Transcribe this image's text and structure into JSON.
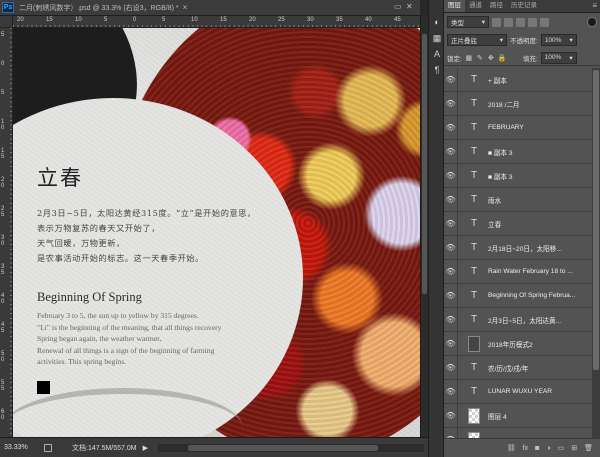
{
  "document": {
    "title": "二月(刺绣风数字）.psd @ 33.3% (右设3，RGB/8) *",
    "close_glyph": "×",
    "ps_badge": "Ps",
    "rulers_h": [
      "20",
      "15",
      "10",
      "5",
      "0",
      "5",
      "10",
      "15",
      "20",
      "25",
      "30",
      "35",
      "40",
      "45"
    ],
    "rulers_v": [
      "5",
      "0",
      "5",
      "10",
      "15",
      "20",
      "25",
      "30",
      "35",
      "40",
      "45",
      "50",
      "55",
      "60"
    ]
  },
  "artwork": {
    "cn_title": "立春",
    "cn_lines": [
      "2月3日~5日，太阳达黄经315度。“立”是开始的意思，",
      "表示万物复苏的春天又开始了，",
      "天气回暖，万物更新，",
      "是农事活动开始的标志。这一天春季开始。"
    ],
    "en_title": "Beginning Of Spring",
    "en_lines": [
      "February 3 to 5, the sun up to yellow by 315 degrees.",
      "\"Li\" is the beginning of the meaning, that all things recovery",
      "Spring began again, the weather warmer,",
      "Renewal of all things is a sign of the beginning of farming",
      "activities. This spring begins."
    ]
  },
  "statusbar": {
    "zoom": "33.33%",
    "doc_size": "文档:147.5M/557.0M",
    "arrow": "▶"
  },
  "panel": {
    "tabs": [
      "图层",
      "通道",
      "路径",
      "历史记录"
    ],
    "active_tab": 0,
    "menu_glyph": "≡",
    "filter_kind": "类型",
    "blend_mode": "正片叠底",
    "opacity_label": "不透明度:",
    "opacity_value": "100%",
    "lock_label": "锁定:",
    "fill_label": "填充:",
    "fill_value": "100%",
    "layers": [
      {
        "name": "+ 副本",
        "kind": "text"
      },
      {
        "name": "2018 /二月",
        "kind": "text"
      },
      {
        "name": "FEBRUARY",
        "kind": "text"
      },
      {
        "name": "■ 副本 3",
        "kind": "text"
      },
      {
        "name": "■ 副本 3",
        "kind": "text"
      },
      {
        "name": "雨水",
        "kind": "text"
      },
      {
        "name": "立春",
        "kind": "text"
      },
      {
        "name": "2月18日~20日，太阳移...",
        "kind": "text"
      },
      {
        "name": "Rain Water February 18 to ...",
        "kind": "text"
      },
      {
        "name": "Beginning Of Spring Februa...",
        "kind": "text"
      },
      {
        "name": "2月3日~5日，太阳达黄...",
        "kind": "text"
      },
      {
        "name": "2018年历模式2",
        "kind": "image-dark"
      },
      {
        "name": "农/历/戊/戌/年",
        "kind": "text"
      },
      {
        "name": "LUNAR WUXU YEAR",
        "kind": "text"
      },
      {
        "name": "图层 4",
        "kind": "image"
      },
      {
        "name": "",
        "kind": "image"
      }
    ],
    "footer_icons": [
      "link-icon",
      "fx-icon",
      "mask-icon",
      "adjustment-icon",
      "group-icon",
      "new-layer-icon",
      "delete-icon"
    ]
  }
}
